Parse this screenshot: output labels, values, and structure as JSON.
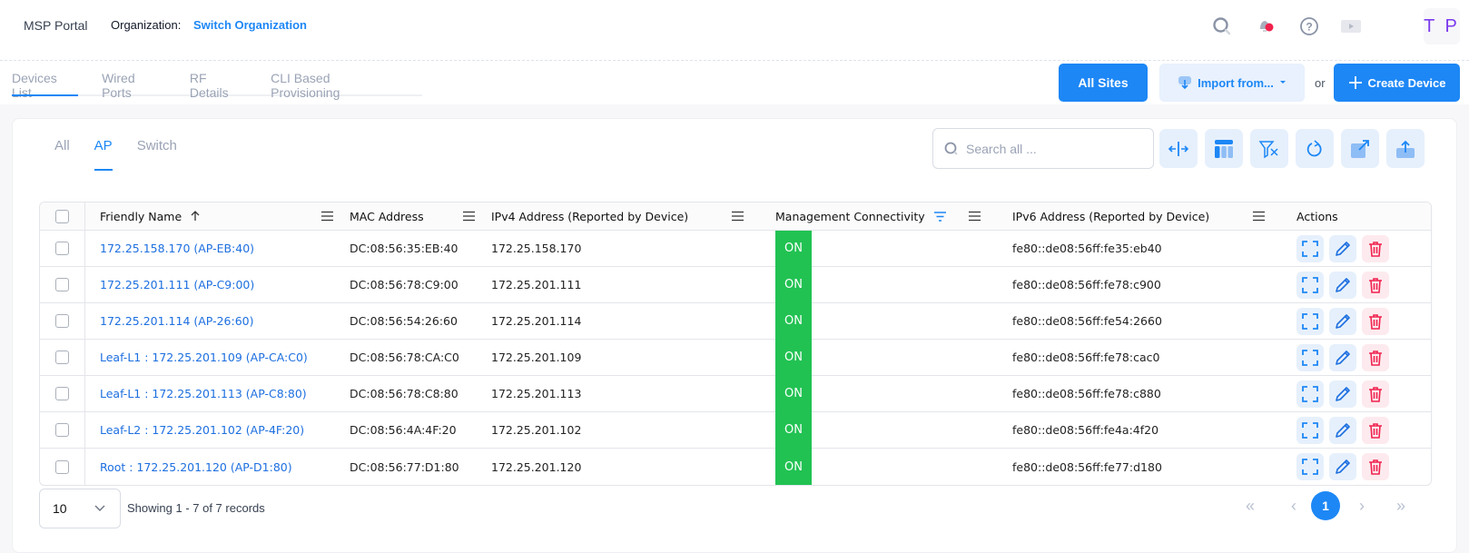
{
  "header": {
    "brand": "MSP Portal",
    "org_label": "Organization:",
    "org_link": "Switch Organization",
    "icons": [
      "search-icon",
      "notification-bell-icon",
      "help-icon",
      "video-play-icon"
    ],
    "avatar_initials": "T P",
    "notification_dot_color": "#f0224e"
  },
  "subtabs": [
    {
      "label": "Devices List",
      "active": true
    },
    {
      "label": "Wired Ports",
      "active": false
    },
    {
      "label": "RF Details",
      "active": false
    },
    {
      "label": "CLI Based Provisioning",
      "active": false
    }
  ],
  "actions": {
    "all_sites": "All Sites",
    "import": "Import from...",
    "or": "or",
    "create": "Create Device"
  },
  "device_tabs": [
    {
      "label": "All",
      "active": false
    },
    {
      "label": "AP",
      "active": true
    },
    {
      "label": "Switch",
      "active": false
    }
  ],
  "search": {
    "placeholder": "Search all ...",
    "value": ""
  },
  "toolbar": [
    "resize-columns-icon",
    "column-layout-icon",
    "clear-filter-icon",
    "refresh-icon",
    "open-external-icon",
    "export-upload-icon"
  ],
  "table": {
    "columns": [
      "Friendly Name",
      "MAC Address",
      "IPv4 Address (Reported by Device)",
      "Management Connectivity",
      "IPv6 Address (Reported by Device)",
      "Actions"
    ],
    "sort": {
      "column": "Friendly Name",
      "direction": "asc"
    },
    "rows": [
      {
        "name": "172.25.158.170 (AP-EB:40)",
        "mac": "DC:08:56:35:EB:40",
        "ipv4": "172.25.158.170",
        "mgmt": "ON",
        "ipv6": "fe80::de08:56ff:fe35:eb40"
      },
      {
        "name": "172.25.201.111 (AP-C9:00)",
        "mac": "DC:08:56:78:C9:00",
        "ipv4": "172.25.201.111",
        "mgmt": "ON",
        "ipv6": "fe80::de08:56ff:fe78:c900"
      },
      {
        "name": "172.25.201.114 (AP-26:60)",
        "mac": "DC:08:56:54:26:60",
        "ipv4": "172.25.201.114",
        "mgmt": "ON",
        "ipv6": "fe80::de08:56ff:fe54:2660"
      },
      {
        "name": "Leaf-L1 : 172.25.201.109 (AP-CA:C0)",
        "mac": "DC:08:56:78:CA:C0",
        "ipv4": "172.25.201.109",
        "mgmt": "ON",
        "ipv6": "fe80::de08:56ff:fe78:cac0"
      },
      {
        "name": "Leaf-L1 : 172.25.201.113 (AP-C8:80)",
        "mac": "DC:08:56:78:C8:80",
        "ipv4": "172.25.201.113",
        "mgmt": "ON",
        "ipv6": "fe80::de08:56ff:fe78:c880"
      },
      {
        "name": "Leaf-L2 : 172.25.201.102 (AP-4F:20)",
        "mac": "DC:08:56:4A:4F:20",
        "ipv4": "172.25.201.102",
        "mgmt": "ON",
        "ipv6": "fe80::de08:56ff:fe4a:4f20"
      },
      {
        "name": "Root : 172.25.201.120 (AP-D1:80)",
        "mac": "DC:08:56:77:D1:80",
        "ipv4": "172.25.201.120",
        "mgmt": "ON",
        "ipv6": "fe80::de08:56ff:fe77:d180"
      }
    ]
  },
  "pagination": {
    "page_size": "10",
    "showing": "Showing 1 - 7 of 7 records",
    "current_page": "1",
    "first": "«",
    "prev": "‹",
    "next": "›",
    "last": "»"
  },
  "colors": {
    "accent": "#1d87f5",
    "on_status": "#21c252",
    "delete": "#f0224e"
  }
}
